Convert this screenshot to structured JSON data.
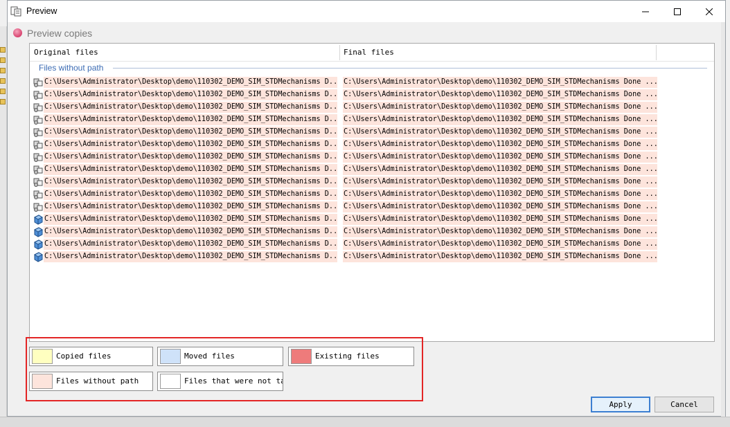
{
  "window": {
    "title": "Preview",
    "controls": {
      "minimize": "minimize",
      "maximize": "maximize",
      "close": "close"
    }
  },
  "header": {
    "title": "Preview copies"
  },
  "columns": {
    "original": "Original files",
    "final": "Final files"
  },
  "group": {
    "title": "Files without path"
  },
  "rows": [
    {
      "icon": "assembly-icon",
      "original": "C:\\Users\\Administrator\\Desktop\\demo\\110302_DEMO_SIM_STDMechanisms D...",
      "final": "C:\\Users\\Administrator\\Desktop\\demo\\110302_DEMO_SIM_STDMechanisms Done ..."
    },
    {
      "icon": "assembly-icon",
      "original": "C:\\Users\\Administrator\\Desktop\\demo\\110302_DEMO_SIM_STDMechanisms D...",
      "final": "C:\\Users\\Administrator\\Desktop\\demo\\110302_DEMO_SIM_STDMechanisms Done ..."
    },
    {
      "icon": "assembly-icon",
      "original": "C:\\Users\\Administrator\\Desktop\\demo\\110302_DEMO_SIM_STDMechanisms D...",
      "final": "C:\\Users\\Administrator\\Desktop\\demo\\110302_DEMO_SIM_STDMechanisms Done ..."
    },
    {
      "icon": "assembly-icon",
      "original": "C:\\Users\\Administrator\\Desktop\\demo\\110302_DEMO_SIM_STDMechanisms D...",
      "final": "C:\\Users\\Administrator\\Desktop\\demo\\110302_DEMO_SIM_STDMechanisms Done ..."
    },
    {
      "icon": "assembly-icon",
      "original": "C:\\Users\\Administrator\\Desktop\\demo\\110302_DEMO_SIM_STDMechanisms D...",
      "final": "C:\\Users\\Administrator\\Desktop\\demo\\110302_DEMO_SIM_STDMechanisms Done ..."
    },
    {
      "icon": "assembly-icon",
      "original": "C:\\Users\\Administrator\\Desktop\\demo\\110302_DEMO_SIM_STDMechanisms D...",
      "final": "C:\\Users\\Administrator\\Desktop\\demo\\110302_DEMO_SIM_STDMechanisms Done ..."
    },
    {
      "icon": "assembly-icon",
      "original": "C:\\Users\\Administrator\\Desktop\\demo\\110302_DEMO_SIM_STDMechanisms D...",
      "final": "C:\\Users\\Administrator\\Desktop\\demo\\110302_DEMO_SIM_STDMechanisms Done ..."
    },
    {
      "icon": "assembly-icon",
      "original": "C:\\Users\\Administrator\\Desktop\\demo\\110302_DEMO_SIM_STDMechanisms D...",
      "final": "C:\\Users\\Administrator\\Desktop\\demo\\110302_DEMO_SIM_STDMechanisms Done ..."
    },
    {
      "icon": "assembly-icon",
      "original": "C:\\Users\\Administrator\\Desktop\\demo\\110302_DEMO_SIM_STDMechanisms D...",
      "final": "C:\\Users\\Administrator\\Desktop\\demo\\110302_DEMO_SIM_STDMechanisms Done ..."
    },
    {
      "icon": "assembly-icon",
      "original": "C:\\Users\\Administrator\\Desktop\\demo\\110302_DEMO_SIM_STDMechanisms D...",
      "final": "C:\\Users\\Administrator\\Desktop\\demo\\110302_DEMO_SIM_STDMechanisms Done ..."
    },
    {
      "icon": "assembly-icon",
      "original": "C:\\Users\\Administrator\\Desktop\\demo\\110302_DEMO_SIM_STDMechanisms D...",
      "final": "C:\\Users\\Administrator\\Desktop\\demo\\110302_DEMO_SIM_STDMechanisms Done ..."
    },
    {
      "icon": "part-icon",
      "original": "C:\\Users\\Administrator\\Desktop\\demo\\110302_DEMO_SIM_STDMechanisms D...",
      "final": "C:\\Users\\Administrator\\Desktop\\demo\\110302_DEMO_SIM_STDMechanisms Done ..."
    },
    {
      "icon": "part-icon",
      "original": "C:\\Users\\Administrator\\Desktop\\demo\\110302_DEMO_SIM_STDMechanisms D...",
      "final": "C:\\Users\\Administrator\\Desktop\\demo\\110302_DEMO_SIM_STDMechanisms Done ..."
    },
    {
      "icon": "part-icon",
      "original": "C:\\Users\\Administrator\\Desktop\\demo\\110302_DEMO_SIM_STDMechanisms D...",
      "final": "C:\\Users\\Administrator\\Desktop\\demo\\110302_DEMO_SIM_STDMechanisms Done ..."
    },
    {
      "icon": "part-icon",
      "original": "C:\\Users\\Administrator\\Desktop\\demo\\110302_DEMO_SIM_STDMechanisms D...",
      "final": "C:\\Users\\Administrator\\Desktop\\demo\\110302_DEMO_SIM_STDMechanisms Done ..."
    }
  ],
  "legend": [
    {
      "label": "Copied files",
      "color": "#ffffc0"
    },
    {
      "label": "Moved files",
      "color": "#cfe2f9"
    },
    {
      "label": "Existing files",
      "color": "#ee7b7b"
    },
    {
      "label": "Files without path",
      "color": "#fde4dc"
    },
    {
      "label": "Files that were not take",
      "color": "#ffffff"
    }
  ],
  "buttons": {
    "apply": "Apply",
    "cancel": "Cancel"
  },
  "colors": {
    "row_highlight": "#fde4dc",
    "group_title": "#3c6cb4",
    "callout_border": "#e32525"
  }
}
